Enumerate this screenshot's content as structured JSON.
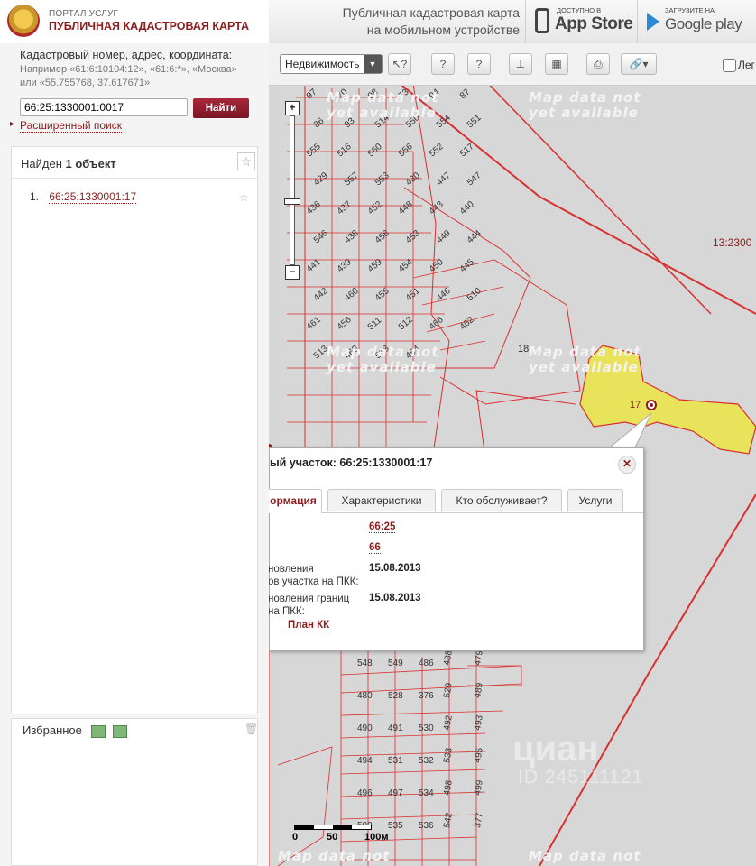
{
  "header": {
    "logo_small": "ПОРТАЛ УСЛУГ",
    "logo_title": "ПУБЛИЧНАЯ КАДАСТРОВАЯ КАРТА",
    "promo_line1": "Публичная кадастровая карта",
    "promo_line2": "на мобильном устройстве",
    "appstore_small": "Доступно в",
    "appstore_big": "App Store",
    "googleplay_small": "ЗАГРУЗИТЕ НА",
    "googleplay_big": "Google play"
  },
  "sidebar": {
    "search_title": "Кадастровый номер, адрес, координата:",
    "search_hint": "Например «61:6:10104:12», «61:6:*», «Москва» или «55.755768, 37.617671»",
    "search_value": "66:25:1330001:0017",
    "find_label": "Найти",
    "advanced_label": "Расширенный поиск",
    "results_prefix": "Найден",
    "results_count": "1 объект",
    "results": [
      {
        "num": "1.",
        "label": "66:25:1330001:17"
      }
    ],
    "favorites_label": "Избранное"
  },
  "toolbar": {
    "layer_select": "Недвижимость",
    "legend_label": "Лег"
  },
  "map": {
    "watermark": "Map data not yet available",
    "watermark_line1": "Map data not",
    "watermark_line2": "yet available",
    "parcel_code": "13:2300",
    "selected_parcel_label": "17",
    "neighbor_label": "18",
    "scale_labels": [
      "0",
      "50",
      "100м"
    ],
    "cian_watermark": "циан",
    "cian_id": "ID 245111121",
    "parcel_labels_top": [
      "97",
      "70",
      "98",
      "73",
      "94",
      "87",
      "86",
      "93",
      "514",
      "550",
      "554",
      "551",
      "555",
      "516",
      "560",
      "556",
      "552",
      "517",
      "429",
      "557",
      "553",
      "430",
      "447",
      "547",
      "436",
      "437",
      "452",
      "448",
      "443",
      "440",
      "546",
      "438",
      "458",
      "453",
      "449",
      "444",
      "441",
      "439",
      "459",
      "454",
      "450",
      "445",
      "442",
      "460",
      "455",
      "451",
      "446",
      "510",
      "461",
      "456",
      "511",
      "512",
      "466",
      "462",
      "513",
      "463",
      "518",
      "464"
    ],
    "parcel_labels_bottom": [
      "548",
      "549",
      "486",
      "488",
      "479",
      "480",
      "528",
      "376",
      "529",
      "489",
      "490",
      "491",
      "530",
      "492",
      "493",
      "494",
      "531",
      "532",
      "533",
      "495",
      "496",
      "497",
      "534",
      "498",
      "499",
      "500",
      "535",
      "536",
      "542",
      "377"
    ]
  },
  "popup": {
    "title": "ый участок: 66:25:1330001:17",
    "tabs": [
      "ормация",
      "Характеристики",
      "Кто обслуживает?",
      "Услуги"
    ],
    "rows": [
      {
        "label": "",
        "value": "66:25"
      },
      {
        "label": "",
        "value": "66"
      },
      {
        "label": "новления\nов участка на ПКК:",
        "value": "15.08.2013"
      },
      {
        "label": "новления границ\nна ПКК:",
        "value": "15.08.2013"
      }
    ],
    "plan_label": "План КК"
  },
  "colors": {
    "accent": "#8c1d1d",
    "parcel_stroke": "#d93030",
    "selected_fill": "#e8e35a",
    "map_bg": "#d7d7d7"
  }
}
